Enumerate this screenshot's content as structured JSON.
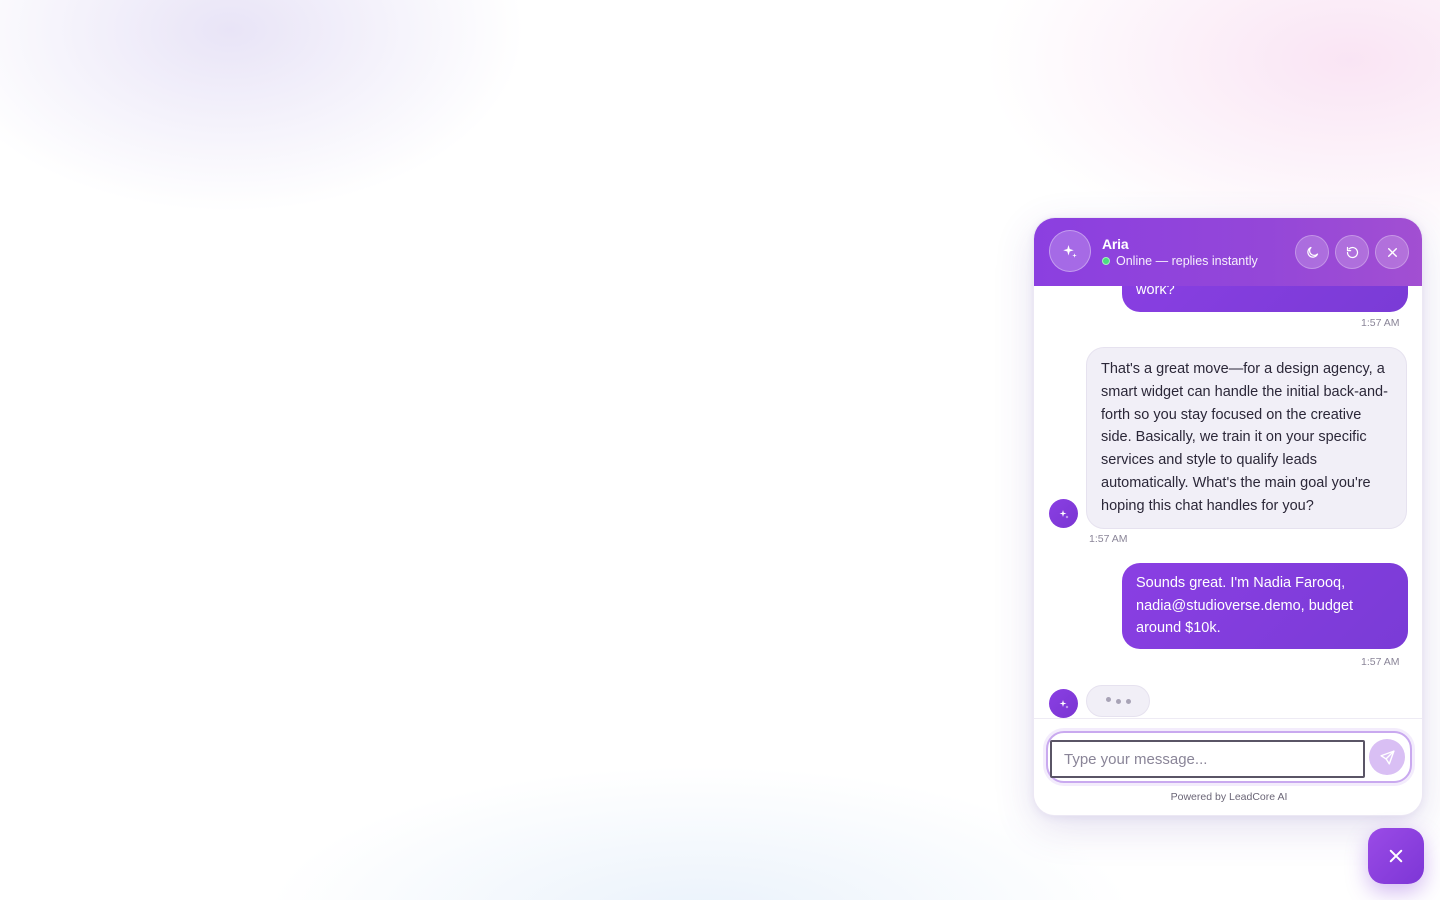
{
  "widget": {
    "agent_name": "Aria",
    "status_text": "Online — replies instantly",
    "status_color": "#4ade80",
    "header_icons": [
      "sparkle-icon",
      "moon-icon",
      "refresh-icon",
      "close-icon"
    ]
  },
  "messages": [
    {
      "role": "user",
      "text": "work?",
      "time": "1:57 AM"
    },
    {
      "role": "bot",
      "text": "That's a great move—for a design agency, a smart widget can handle the initial back-and-forth so you stay focused on the creative side. Basically, we train it on your specific services and style to qualify leads automatically. What's the main goal you're hoping this chat handles for you?",
      "time": "1:57 AM"
    },
    {
      "role": "user",
      "text": "Sounds great. I'm Nadia Farooq, nadia@studioverse.demo, budget around $10k.",
      "time": "1:57 AM"
    }
  ],
  "composer": {
    "placeholder": "Type your message...",
    "value": "",
    "powered_by": "Powered by LeadCore AI"
  },
  "colors": {
    "accent": "#8b3fe0",
    "user_bubble": "#7e3cdb",
    "bot_bubble": "#f1eff7"
  }
}
